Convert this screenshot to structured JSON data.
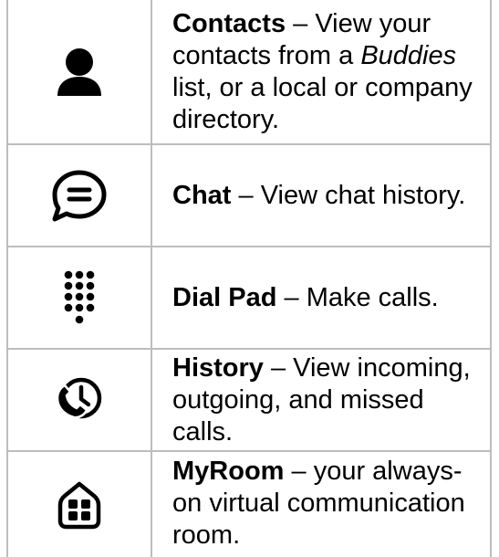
{
  "rows": [
    {
      "icon": "person-icon",
      "term": "Contacts",
      "sep": " – ",
      "desc_before": "View your contacts from a ",
      "desc_em": "Buddies",
      "desc_after": " list, or a local or company directory."
    },
    {
      "icon": "chat-bubble-icon",
      "term": "Chat",
      "sep": " – ",
      "desc": "View chat history."
    },
    {
      "icon": "dial-pad-icon",
      "term": "Dial Pad",
      "sep": " – ",
      "desc": "Make calls."
    },
    {
      "icon": "history-icon",
      "term": "History",
      "sep": " – ",
      "desc": "View incoming, outgoing, and missed calls."
    },
    {
      "icon": "myroom-icon",
      "term": "MyRoom",
      "sep": " – ",
      "desc": "your always-on virtual communication room."
    }
  ]
}
